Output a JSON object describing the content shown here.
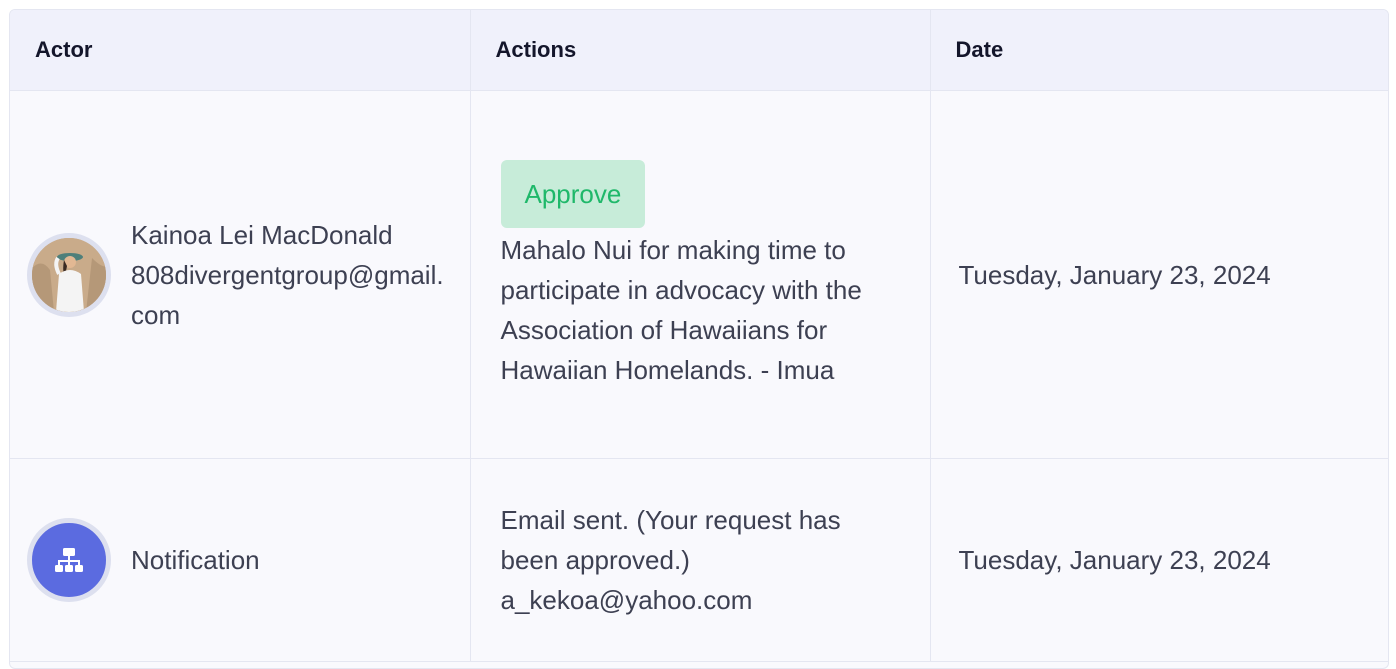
{
  "table": {
    "headers": [
      "Actor",
      "Actions",
      "Date"
    ],
    "rows": [
      {
        "actor_name": "Kainoa Lei MacDonald",
        "actor_email": "808divergentgroup@gmail.com",
        "avatar_icon": "user-photo-avatar",
        "badge": "Approve",
        "message": "Mahalo Nui for making time to participate in advocacy with the Association of Hawaiians for Hawaiian Homelands. - Imua",
        "date": "Tuesday, January 23, 2024"
      },
      {
        "actor_name": "Notification",
        "avatar_icon": "workflow-icon",
        "message": "Email sent. (Your request has been approved.) a_kekoa@yahoo.com",
        "date": "Tuesday, January 23, 2024"
      }
    ]
  },
  "colors": {
    "approve_bg": "#c7ecd9",
    "approve_text": "#1fb86a",
    "notification_avatar": "#5b6be0"
  }
}
